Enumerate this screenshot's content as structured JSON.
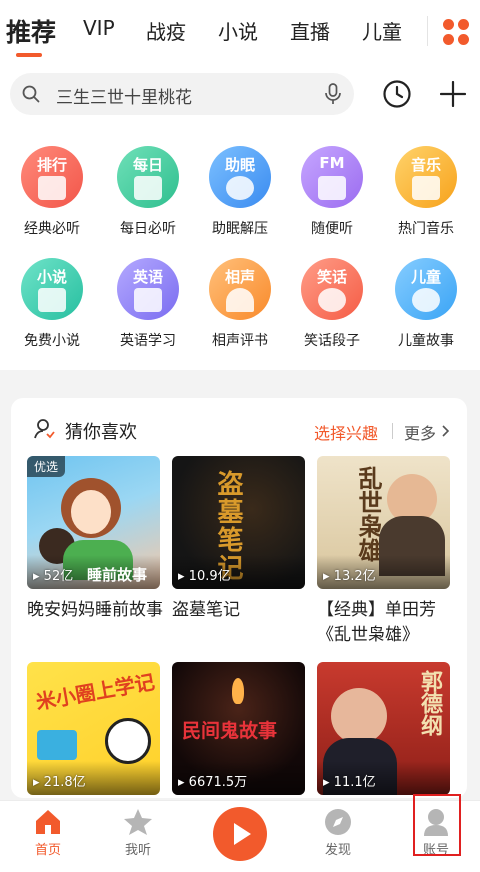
{
  "tabs": [
    {
      "label": "推荐",
      "active": true
    },
    {
      "label": "VIP"
    },
    {
      "label": "战疫"
    },
    {
      "label": "小说"
    },
    {
      "label": "直播"
    },
    {
      "label": "儿童"
    }
  ],
  "colors": {
    "accent": "#f25a2c"
  },
  "search": {
    "placeholder": "三生三世十里桃花"
  },
  "icons": {
    "history": "history-clock-icon",
    "add": "plus-icon",
    "grid": "category-grid-icon",
    "search": "search-icon",
    "mic": "mic-icon"
  },
  "categories": [
    {
      "badge": "排行",
      "label": "经典必听",
      "color": "#f2564a"
    },
    {
      "badge": "每日",
      "label": "每日必听",
      "color": "#2fbf8f"
    },
    {
      "badge": "助眠",
      "label": "助眠解压",
      "color": "#3a8bf0"
    },
    {
      "badge": "FM",
      "label": "随便听",
      "color": "#9b6cf0"
    },
    {
      "badge": "音乐",
      "label": "热门音乐",
      "color": "#f7a21b"
    },
    {
      "badge": "小说",
      "label": "免费小说",
      "color": "#27bfa0"
    },
    {
      "badge": "英语",
      "label": "英语学习",
      "color": "#7a6cf0"
    },
    {
      "badge": "相声",
      "label": "相声评书",
      "color": "#f98a2b"
    },
    {
      "badge": "笑话",
      "label": "笑话段子",
      "color": "#f55c45"
    },
    {
      "badge": "儿童",
      "label": "儿童故事",
      "color": "#3aa4f5"
    }
  ],
  "recommend": {
    "title": "猜你喜欢",
    "select_label": "选择兴趣",
    "more_label": "更多",
    "albums": [
      {
        "title": "晚安妈妈睡前故事",
        "plays": "52亿",
        "badge": "优选",
        "cover_text": "睡前故事"
      },
      {
        "title": "盗墓笔记",
        "plays": "10.9亿",
        "cover_text": "盗墓笔记"
      },
      {
        "title": "【经典】单田芳《乱世枭雄》",
        "plays": "13.2亿",
        "cover_text": "乱世枭雄"
      },
      {
        "title": "",
        "plays": "21.8亿",
        "cover_text": "米小圈上学记"
      },
      {
        "title": "",
        "plays": "6671.5万",
        "cover_text": "民间鬼故事"
      },
      {
        "title": "",
        "plays": "11.1亿",
        "cover_text": "郭德纲"
      }
    ]
  },
  "bottom_nav": [
    {
      "label": "首页",
      "active": true
    },
    {
      "label": "我听"
    },
    {
      "label": "发现"
    },
    {
      "label": "账号"
    }
  ]
}
